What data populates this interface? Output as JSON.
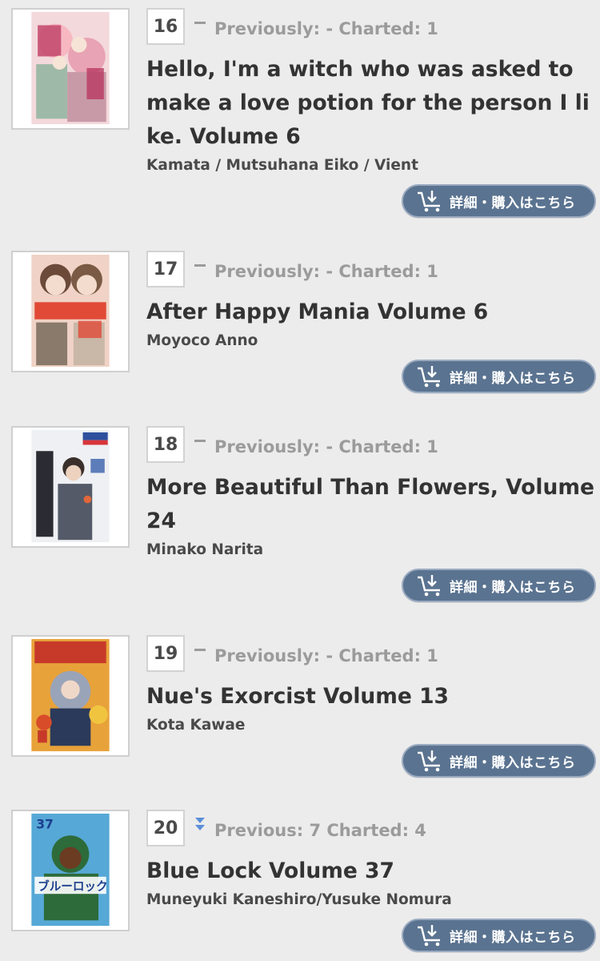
{
  "theme": {
    "background": "#ececec",
    "button_color": "#5a7390",
    "trend_down_color": "#5b8fd8",
    "muted_text": "#9b9b9b"
  },
  "entries": [
    {
      "rank": "16",
      "trend_icon": "dash-icon",
      "prev_info": "Previously: - Charted: 1",
      "title": "Hello, I'm a witch who was asked to make a love potion for the person I like. Volume 6",
      "author": "Kamata / Mutsuhana Eiko / Vient",
      "button_label": "詳細・購入はこちら",
      "cover_icon": "manga-cover-witch-love-potion"
    },
    {
      "rank": "17",
      "trend_icon": "dash-icon",
      "prev_info": "Previously: - Charted: 1",
      "title": "After Happy Mania Volume 6",
      "author": "Moyoco Anno",
      "button_label": "詳細・購入はこちら",
      "cover_icon": "manga-cover-after-happy-mania"
    },
    {
      "rank": "18",
      "trend_icon": "dash-icon",
      "prev_info": "Previously: - Charted: 1",
      "title": "More Beautiful Than Flowers, Volume 24",
      "author": "Minako Narita",
      "button_label": "詳細・購入はこちら",
      "cover_icon": "manga-cover-more-beautiful-than-flowers"
    },
    {
      "rank": "19",
      "trend_icon": "dash-icon",
      "prev_info": "Previously: - Charted: 1",
      "title": "Nue's Exorcist Volume 13",
      "author": "Kota Kawae",
      "button_label": "詳細・購入はこちら",
      "cover_icon": "manga-cover-nues-exorcist"
    },
    {
      "rank": "20",
      "trend_icon": "down-arrow-icon",
      "prev_info": "Previous: 7 Charted: 4",
      "title": "Blue Lock Volume 37",
      "author": "Muneyuki Kaneshiro/Yusuke Nomura",
      "button_label": "詳細・購入はこちら",
      "cover_icon": "manga-cover-blue-lock",
      "cover_volume_number": "37",
      "cover_title_text": "ブルーロック"
    }
  ]
}
